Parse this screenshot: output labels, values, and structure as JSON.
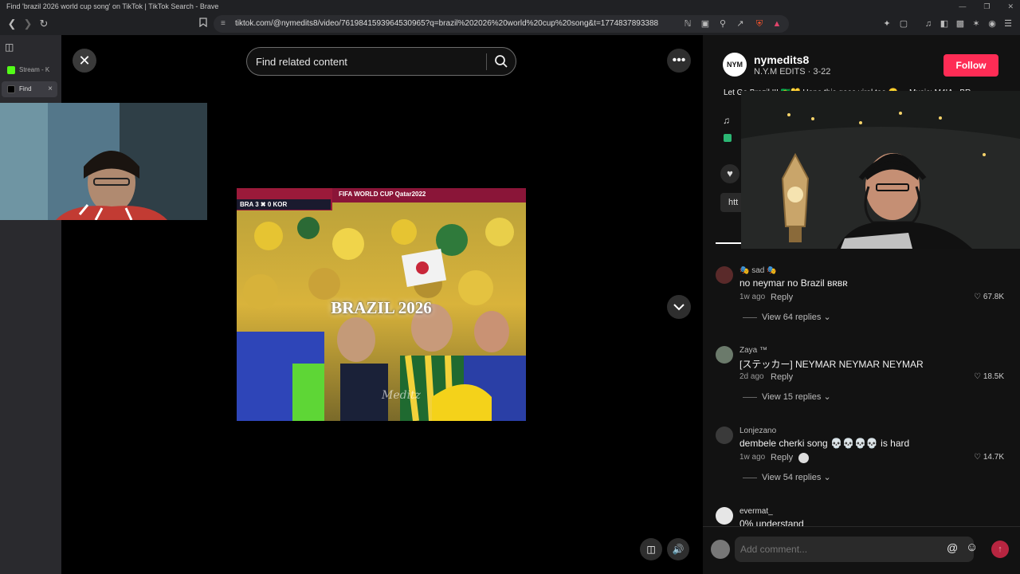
{
  "window": {
    "title": "Find 'brazil 2026 world cup song' on TikTok | TikTok Search - Brave",
    "minimize": "—",
    "restore": "❐",
    "close": "✕"
  },
  "browser": {
    "url": "tiktok.com/@nymedits8/video/7619841593964530965?q=brazil%202026%20world%20cup%20song&t=1774837893388"
  },
  "tabs": [
    {
      "label": "Stream - K",
      "color": "#53fc18"
    },
    {
      "label": "Find",
      "color": "#000000",
      "close": "×"
    }
  ],
  "search": {
    "placeholder": "Find related content"
  },
  "video": {
    "scoreboard": "BRA 3 ✖ 0 KOR",
    "banner": "FIFA WORLD CUP Qatar2022",
    "overlay_text": "BRAZIL 2026",
    "watermark": "Meditz"
  },
  "post": {
    "avatar_text": "NYM",
    "username": "nymedits8",
    "subline": "N.Y.M EDITS · 3-22",
    "follow_label": "Follow",
    "description": "Let Go Brazil !!! 🇧🇷💛 Hope this goes viral too 😁 ... Music: M4IA - BR",
    "link_preview": "htt"
  },
  "comments": [
    {
      "name": "🎭 sad 🎭",
      "text": "no neymar no Brazil ʙʀʙʀ",
      "time": "1w ago",
      "reply": "Reply",
      "likes": "67.8K",
      "view_replies": "View 64 replies",
      "avatar_color": "#5a2a2a"
    },
    {
      "name": "Zaya ™",
      "text": "[ステッカー] NEYMAR NEYMAR NEYMAR",
      "time": "2d ago",
      "reply": "Reply",
      "likes": "18.5K",
      "view_replies": "View 15 replies",
      "avatar_color": "#6b7a6b"
    },
    {
      "name": "Lonjezano",
      "text": "dembele cherki song 💀💀💀💀 is hard",
      "time": "1w ago",
      "reply": "Reply",
      "likes": "14.7K",
      "view_replies": "View 54 replies",
      "avatar_color": "#3a3a3a"
    },
    {
      "name": "evermat_",
      "text": "0% understand",
      "time": "",
      "reply": "",
      "likes": "",
      "view_replies": "",
      "avatar_color": "#e6e6e6"
    }
  ],
  "comment_input": {
    "placeholder": "Add comment...",
    "at_symbol": "@",
    "emoji": "☺",
    "post_icon": "↑"
  },
  "colors": {
    "accent": "#fe2c55",
    "panel": "#121212",
    "sidebar": "#2a2a2e"
  }
}
